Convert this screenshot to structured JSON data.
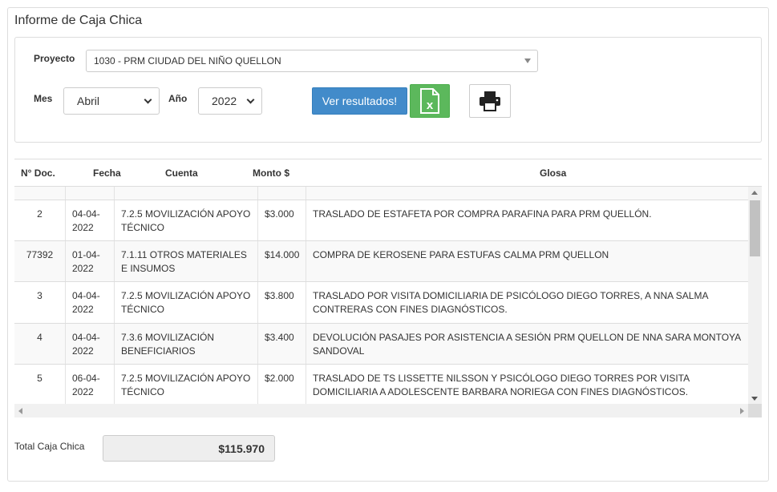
{
  "panel": {
    "title": "Informe de Caja Chica"
  },
  "filters": {
    "proyecto_label": "Proyecto",
    "proyecto_value": "1030 - PRM CIUDAD DEL NIÑO QUELLON",
    "mes_label": "Mes",
    "mes_value": "Abril",
    "anio_label": "Año",
    "anio_value": "2022"
  },
  "actions": {
    "ver_resultados_label": "Ver resultados!",
    "excel_icon": "excel-file-icon",
    "print_icon": "printer-icon"
  },
  "table": {
    "columns": [
      "N° Doc.",
      "Fecha",
      "Cuenta",
      "Monto $",
      "Glosa"
    ],
    "rows": [
      {
        "doc": "2",
        "fecha": "04-04-2022",
        "cuenta": "7.2.5 MOVILIZACIÓN APOYO TÉCNICO",
        "monto": "$3.000",
        "glosa": "TRASLADO DE ESTAFETA POR COMPRA PARAFINA PARA PRM QUELLÓN."
      },
      {
        "doc": "77392",
        "fecha": "01-04-2022",
        "cuenta": "7.1.11 OTROS MATERIALES E INSUMOS",
        "monto": "$14.000",
        "glosa": "COMPRA DE KEROSENE PARA ESTUFAS CALMA PRM QUELLON"
      },
      {
        "doc": "3",
        "fecha": "04-04-2022",
        "cuenta": "7.2.5 MOVILIZACIÓN APOYO TÉCNICO",
        "monto": "$3.800",
        "glosa": "TRASLADO POR VISITA DOMICILIARIA DE PSICÓLOGO DIEGO TORRES, A NNA SALMA CONTRERAS CON FINES DIAGNÓSTICOS."
      },
      {
        "doc": "4",
        "fecha": "04-04-2022",
        "cuenta": "7.3.6 MOVILIZACIÓN BENEFICIARIOS",
        "monto": "$3.400",
        "glosa": "DEVOLUCIÓN PASAJES POR ASISTENCIA A SESIÓN PRM QUELLON DE NNA SARA MONTOYA SANDOVAL"
      },
      {
        "doc": "5",
        "fecha": "06-04-2022",
        "cuenta": "7.2.5 MOVILIZACIÓN APOYO TÉCNICO",
        "monto": "$2.000",
        "glosa": "TRASLADO DE TS LISSETTE NILSSON Y PSICÓLOGO DIEGO TORRES POR VISITA DOMICILIARIA A ADOLESCENTE BARBARA NORIEGA CON FINES DIAGNÓSTICOS."
      }
    ]
  },
  "total": {
    "label": "Total Caja Chica",
    "value": "$115.970"
  }
}
